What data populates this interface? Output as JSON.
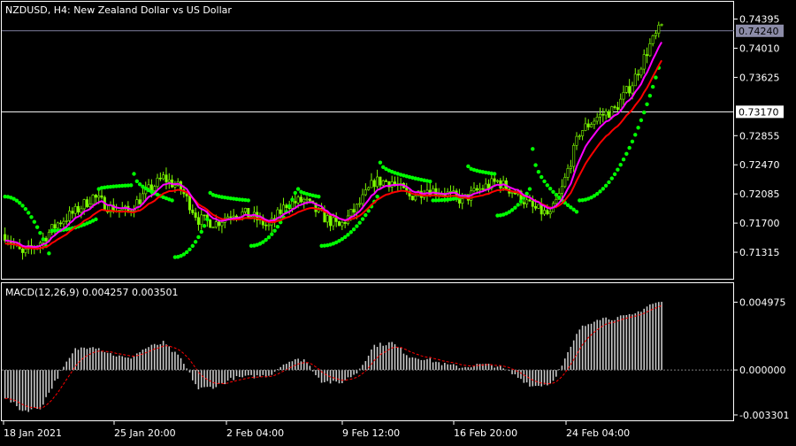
{
  "header": {
    "symbol_line": "NZDUSD, H4:  New Zealand Dollar vs US Dollar"
  },
  "indicator_header": "MACD(12,26,9) 0.004257 0.003501",
  "colors": {
    "background": "#000000",
    "grid": "#ffffff",
    "candle_up": "#7cfc00",
    "candle_down": "#7cfc00",
    "sar": "#00ff00",
    "ma_fast": "#ff00ff",
    "ma_slow": "#ff0000",
    "macd_hist": "#c8c8c8",
    "macd_signal": "#ff0000",
    "price_line": "#8080a0",
    "text": "#ffffff"
  },
  "price_axis": {
    "ticks": [
      "0.74395",
      "0.74010",
      "0.73625",
      "0.72855",
      "0.72470",
      "0.72085",
      "0.71700",
      "0.71315"
    ],
    "tick_values": [
      0.74395,
      0.7401,
      0.73625,
      0.72855,
      0.7247,
      0.72085,
      0.717,
      0.71315
    ],
    "current_bid": "0.74240",
    "current_bid_value": 0.7424,
    "horizontal_line": "0.73170",
    "horizontal_line_value": 0.7317,
    "range": [
      0.71,
      0.746
    ]
  },
  "macd_axis": {
    "ticks": [
      "0.004975",
      "0.000000",
      "-0.003301"
    ],
    "tick_values": [
      0.004975,
      0.0,
      -0.003301
    ],
    "range": [
      -0.0035,
      0.0052
    ]
  },
  "time_axis": {
    "labels": [
      "18 Jan 2021",
      "25 Jan 20:00",
      "2 Feb 04:00",
      "9 Feb 12:00",
      "16 Feb 20:00",
      "24 Feb 04:00"
    ]
  },
  "chart_data": {
    "type": "line",
    "symbol": "NZDUSD",
    "timeframe": "H4",
    "price_path_knots": [
      [
        0,
        0.7155
      ],
      [
        6,
        0.7128
      ],
      [
        12,
        0.7145
      ],
      [
        18,
        0.717
      ],
      [
        24,
        0.7185
      ],
      [
        30,
        0.7205
      ],
      [
        36,
        0.719
      ],
      [
        42,
        0.7185
      ],
      [
        48,
        0.721
      ],
      [
        54,
        0.723
      ],
      [
        60,
        0.7215
      ],
      [
        66,
        0.7175
      ],
      [
        72,
        0.717
      ],
      [
        78,
        0.7185
      ],
      [
        84,
        0.718
      ],
      [
        90,
        0.7165
      ],
      [
        96,
        0.7195
      ],
      [
        102,
        0.72
      ],
      [
        108,
        0.718
      ],
      [
        114,
        0.7165
      ],
      [
        120,
        0.719
      ],
      [
        126,
        0.7225
      ],
      [
        132,
        0.7225
      ],
      [
        138,
        0.7205
      ],
      [
        144,
        0.7215
      ],
      [
        150,
        0.721
      ],
      [
        156,
        0.72
      ],
      [
        162,
        0.7215
      ],
      [
        168,
        0.7225
      ],
      [
        174,
        0.721
      ],
      [
        180,
        0.719
      ],
      [
        186,
        0.718
      ],
      [
        190,
        0.7215
      ],
      [
        196,
        0.729
      ],
      [
        202,
        0.731
      ],
      [
        208,
        0.732
      ],
      [
        214,
        0.7355
      ],
      [
        220,
        0.7405
      ],
      [
        224,
        0.743
      ]
    ],
    "sar_segments": [
      {
        "from": 0,
        "to": 16,
        "start": 0.7205,
        "end": 0.713,
        "side": "below"
      },
      {
        "from": 16,
        "to": 32,
        "start": 0.716,
        "end": 0.7175,
        "side": "below"
      },
      {
        "from": 32,
        "to": 44,
        "start": 0.7215,
        "end": 0.722,
        "side": "above"
      },
      {
        "from": 44,
        "to": 58,
        "start": 0.7235,
        "end": 0.72,
        "side": "above"
      },
      {
        "from": 58,
        "to": 70,
        "start": 0.7125,
        "end": 0.7175,
        "side": "below"
      },
      {
        "from": 70,
        "to": 84,
        "start": 0.721,
        "end": 0.72,
        "side": "above"
      },
      {
        "from": 84,
        "to": 100,
        "start": 0.714,
        "end": 0.721,
        "side": "below"
      },
      {
        "from": 100,
        "to": 108,
        "start": 0.7215,
        "end": 0.7205,
        "side": "above"
      },
      {
        "from": 108,
        "to": 128,
        "start": 0.714,
        "end": 0.7205,
        "side": "below"
      },
      {
        "from": 128,
        "to": 146,
        "start": 0.725,
        "end": 0.7225,
        "side": "above"
      },
      {
        "from": 146,
        "to": 158,
        "start": 0.72,
        "end": 0.7205,
        "side": "below"
      },
      {
        "from": 158,
        "to": 168,
        "start": 0.7245,
        "end": 0.7235,
        "side": "above"
      },
      {
        "from": 168,
        "to": 180,
        "start": 0.718,
        "end": 0.7215,
        "side": "below"
      },
      {
        "from": 180,
        "to": 196,
        "start": 0.7268,
        "end": 0.7185,
        "side": "above"
      },
      {
        "from": 196,
        "to": 224,
        "start": 0.72,
        "end": 0.7375,
        "side": "below"
      }
    ],
    "macd_hist_knots": [
      [
        0,
        -0.002
      ],
      [
        6,
        -0.003
      ],
      [
        12,
        -0.0028
      ],
      [
        18,
        -0.0005
      ],
      [
        24,
        0.0015
      ],
      [
        30,
        0.0018
      ],
      [
        36,
        0.0012
      ],
      [
        42,
        0.0008
      ],
      [
        48,
        0.0016
      ],
      [
        54,
        0.002
      ],
      [
        60,
        0.0008
      ],
      [
        66,
        -0.0014
      ],
      [
        72,
        -0.0012
      ],
      [
        78,
        -0.0006
      ],
      [
        84,
        -0.0005
      ],
      [
        90,
        -0.0004
      ],
      [
        96,
        0.0006
      ],
      [
        102,
        0.0008
      ],
      [
        108,
        -0.0008
      ],
      [
        114,
        -0.001
      ],
      [
        120,
        -0.0002
      ],
      [
        126,
        0.0018
      ],
      [
        132,
        0.002
      ],
      [
        138,
        0.001
      ],
      [
        144,
        0.0008
      ],
      [
        150,
        0.0004
      ],
      [
        156,
        0.0002
      ],
      [
        162,
        0.0004
      ],
      [
        168,
        0.0003
      ],
      [
        174,
        -0.0004
      ],
      [
        180,
        -0.0012
      ],
      [
        186,
        -0.001
      ],
      [
        190,
        0.0003
      ],
      [
        196,
        0.003
      ],
      [
        202,
        0.0038
      ],
      [
        208,
        0.0038
      ],
      [
        214,
        0.004
      ],
      [
        220,
        0.0048
      ],
      [
        224,
        0.005
      ]
    ]
  }
}
